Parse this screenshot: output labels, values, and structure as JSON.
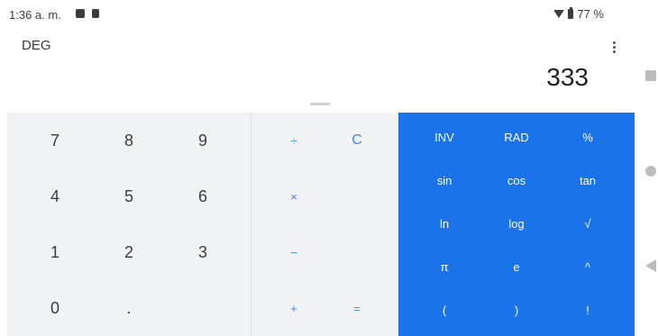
{
  "status_bar": {
    "time": "1:36 a. m.",
    "battery": "77 %"
  },
  "header": {
    "mode": "DEG",
    "menu_icon": "more-vert-icon"
  },
  "display": {
    "value": "333"
  },
  "number_pad": {
    "keys": [
      {
        "label": "7"
      },
      {
        "label": "8"
      },
      {
        "label": "9"
      },
      {
        "label": "4"
      },
      {
        "label": "5"
      },
      {
        "label": "6"
      },
      {
        "label": "1"
      },
      {
        "label": "2"
      },
      {
        "label": "3"
      },
      {
        "label": "0"
      },
      {
        "label": "."
      }
    ]
  },
  "operators": {
    "divide": "÷",
    "clear": "C",
    "multiply": "×",
    "minus": "−",
    "plus": "+",
    "equals": "="
  },
  "advanced": {
    "keys": [
      {
        "label": "INV"
      },
      {
        "label": "RAD"
      },
      {
        "label": "%"
      },
      {
        "label": "sin"
      },
      {
        "label": "cos"
      },
      {
        "label": "tan"
      },
      {
        "label": "ln"
      },
      {
        "label": "log"
      },
      {
        "label": "√"
      },
      {
        "label": "π"
      },
      {
        "label": "e"
      },
      {
        "label": "^"
      },
      {
        "label": "("
      },
      {
        "label": ")"
      },
      {
        "label": "!"
      }
    ]
  },
  "colors": {
    "accent": "#1a73e8",
    "pad_background": "#f1f3f4",
    "operator_text": "#4285f4"
  }
}
